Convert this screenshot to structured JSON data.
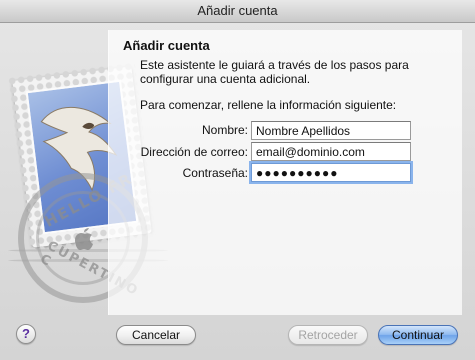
{
  "window": {
    "title": "Añadir cuenta"
  },
  "panel": {
    "title": "Añadir cuenta",
    "description": "Este asistente le guiará a través de los pasos para configurar una cuenta adicional.",
    "prompt": "Para comenzar, rellene la información siguiente:"
  },
  "form": {
    "name_label": "Nombre:",
    "name_value": "Nombre Apellidos",
    "email_label": "Dirección de correo:",
    "email_value": "email@dominio.com",
    "password_label": "Contraseña:",
    "password_value": "●●●●●●●●●●"
  },
  "stamp": {
    "postmark_top": "HELLO FR",
    "postmark_bottom": "CUPERTINO C"
  },
  "footer": {
    "help_label": "?",
    "cancel_label": "Cancelar",
    "back_label": "Retroceder",
    "continue_label": "Continuar"
  },
  "colors": {
    "accent": "#6ea3e9",
    "focus_ring": "#8ab4ec"
  }
}
